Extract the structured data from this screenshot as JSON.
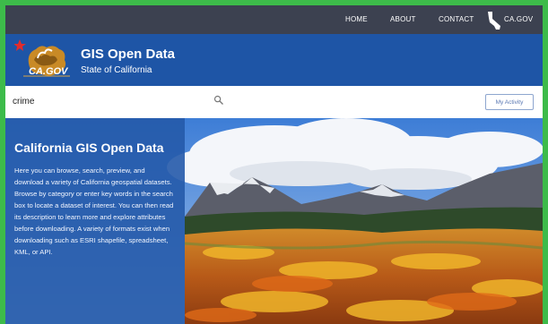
{
  "nav": {
    "home": "HOME",
    "about": "ABOUT",
    "contact": "CONTACT",
    "cagov": "CA.GOV"
  },
  "header": {
    "logo_text": "CA.GOV",
    "title": "GIS Open Data",
    "subtitle": "State of California"
  },
  "search": {
    "value": "crime",
    "icon": "search-icon"
  },
  "activity_button": "My Activity",
  "panel": {
    "title": "California GIS Open Data",
    "body": "Here you can browse, search, preview, and download a variety of California geospatial datasets. Browse by category or enter key words in the search box to locate a dataset of interest. You can then read its description to learn more and explore attributes before downloading. A variety of formats exist when downloading such as ESRI shapefile, spreadsheet, KML, or API."
  },
  "colors": {
    "page_border": "#3dbb4a",
    "nav_bg": "#3c4150",
    "header_bg": "#1e55a6",
    "panel_bg": "#255aaa",
    "logo_star": "#e32b2b",
    "logo_gold": "#c98a26"
  }
}
